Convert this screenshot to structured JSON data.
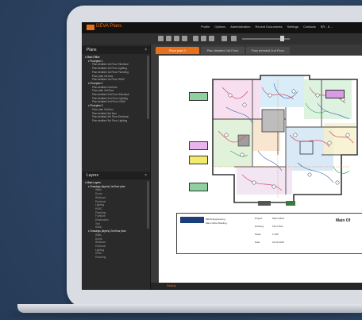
{
  "app": {
    "title": "DEVA Plans",
    "menu": [
      "Profile",
      "Options",
      "Administration",
      "Recent Documents",
      "Settings",
      "Contacts",
      "ER - 6 ..."
    ]
  },
  "sidebar": {
    "top_panel_title": "Plans",
    "close_glyph": "×",
    "tree_top": [
      {
        "level": 0,
        "label": "▾ Main Office"
      },
      {
        "level": 1,
        "label": "▾ Floorplan 1"
      },
      {
        "level": 2,
        "label": "Plan detailed 1st Floor Electrical"
      },
      {
        "level": 2,
        "label": "Plan detailed 1st Floor Lighting"
      },
      {
        "level": 2,
        "label": "Plan detailed 1st Floor Plumbing"
      },
      {
        "level": 2,
        "label": "Floor plan 1st floor"
      },
      {
        "level": 2,
        "label": "Plan detailed 1st Floor HVAC"
      },
      {
        "level": 1,
        "label": "▾ Floorplan 2"
      },
      {
        "level": 2,
        "label": "Plan detailed 2nd floor"
      },
      {
        "level": 2,
        "label": "Floor plan 2nd floor"
      },
      {
        "level": 2,
        "label": "Plan detailed 2nd Floor Electrical"
      },
      {
        "level": 2,
        "label": "Plan detailed 2nd Floor Lighting"
      },
      {
        "level": 2,
        "label": "Plan detailed 2nd Floor HVAC"
      },
      {
        "level": 1,
        "label": "▾ Floorplan 3"
      },
      {
        "level": 2,
        "label": "Floor plan 3rd floor"
      },
      {
        "level": 2,
        "label": "Plan detailed 3rd floor"
      },
      {
        "level": 2,
        "label": "Plan detailed 3rd Floor Electrical"
      },
      {
        "level": 2,
        "label": "Plan detailed 3rd Floor Lighting"
      }
    ],
    "bottom_panel_title": "Layers",
    "tree_bottom": [
      {
        "level": 0,
        "label": "▾ Main Layers"
      },
      {
        "level": 1,
        "label": "▾ Drawings (layers) 1st floor plan"
      },
      {
        "level": 3,
        "label": "Walls"
      },
      {
        "level": 3,
        "label": "Doors"
      },
      {
        "level": 3,
        "label": "Windows"
      },
      {
        "level": 3,
        "label": "Electrical"
      },
      {
        "level": 3,
        "label": "Lighting"
      },
      {
        "level": 3,
        "label": "HVAC"
      },
      {
        "level": 3,
        "label": "Plumbing"
      },
      {
        "level": 3,
        "label": "Furniture"
      },
      {
        "level": 3,
        "label": "Dimensions"
      },
      {
        "level": 3,
        "label": "Text"
      },
      {
        "level": 3,
        "label": "Hatch"
      },
      {
        "level": 1,
        "label": "▾ Drawings (layers) 2nd floor plan"
      },
      {
        "level": 3,
        "label": "Walls"
      },
      {
        "level": 3,
        "label": "Doors"
      },
      {
        "level": 3,
        "label": "Windows"
      },
      {
        "level": 3,
        "label": "Electrical"
      },
      {
        "level": 3,
        "label": "Lighting"
      },
      {
        "level": 3,
        "label": "HVAC"
      },
      {
        "level": 3,
        "label": "Plumbing"
      }
    ]
  },
  "tabs": [
    {
      "label": "Floor plan 1",
      "active": true
    },
    {
      "label": "Plan detailed 1st Floor",
      "active": false
    },
    {
      "label": "Plan detailed 2nd Floor",
      "active": false
    }
  ],
  "titleblock": {
    "company": "DEVA Engineering",
    "address": "Main Office Building",
    "project_label": "Project",
    "project_value": "Main Office",
    "drawing_label": "Drawing",
    "drawing_value": "Floor Plan",
    "scale_label": "Scale",
    "scale_value": "1:100",
    "date_label": "Date",
    "date_value": "01.02.2016",
    "sheet_title": "Main Of"
  },
  "status": {
    "text": "Ready"
  },
  "colors": {
    "accent": "#e8701a",
    "background": "#2f4766"
  }
}
